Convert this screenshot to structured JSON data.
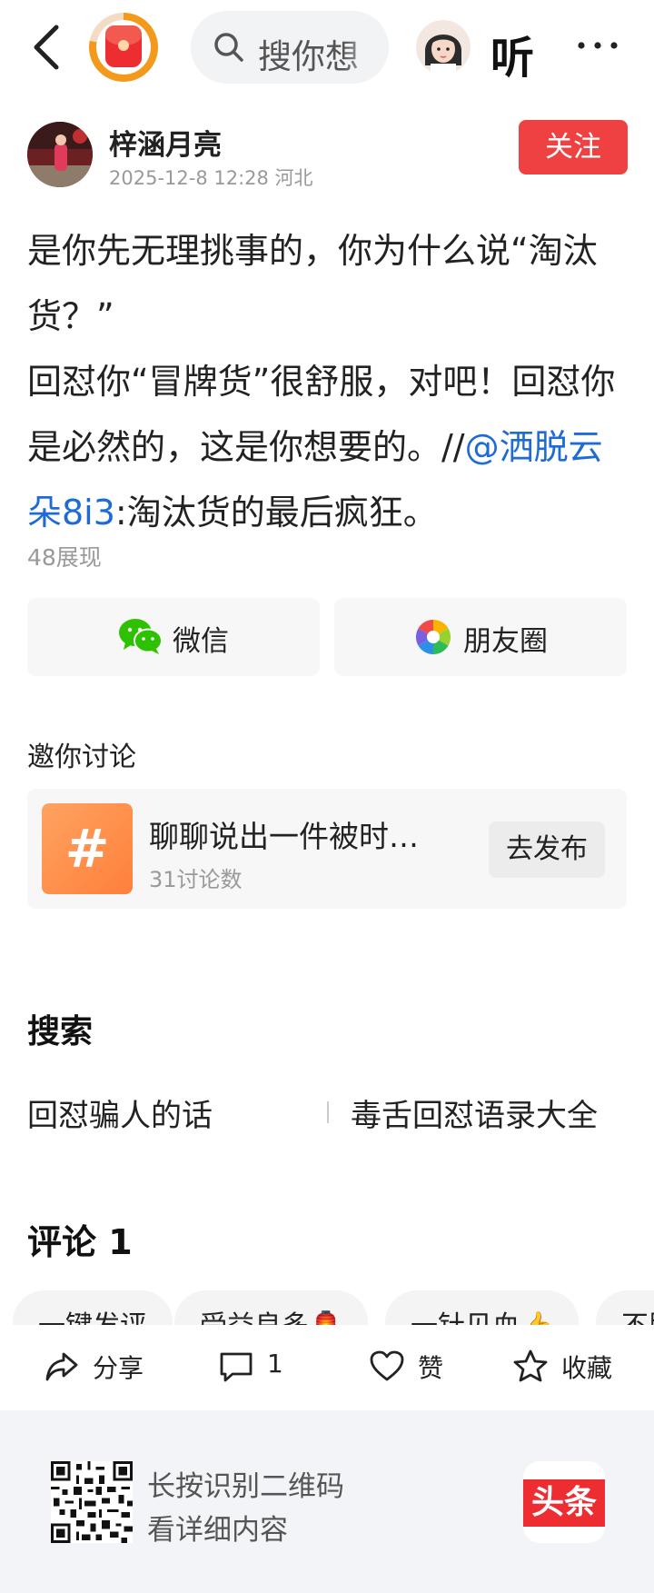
{
  "topbar": {
    "search_placeholder": "搜你想",
    "listen_label": "听"
  },
  "author": {
    "name": "梓涵月亮",
    "meta": "2025-12-8 12:28  河北",
    "follow_label": "关注"
  },
  "post": {
    "line1": "是你先无理挑事的，你为什么说“淘汰货？”",
    "line2_before_mention": "回怼你“冒牌货”很舒服，对吧！回怼你是必然的，这是你想要的。//",
    "mention": "@洒脱云朵8i3",
    "after_mention": ":淘汰货的最后疯狂。",
    "views": "48展现"
  },
  "share": {
    "wechat_label": "微信",
    "moments_label": "朋友圈"
  },
  "invite": {
    "title": "邀你讨论",
    "topic_title": "聊聊说出一件被时…",
    "topic_count": "31讨论数",
    "publish_label": "去发布",
    "topic_icon_glyph": "#"
  },
  "search_section": {
    "title": "搜索",
    "suggestions": [
      "回怼骗人的话",
      "毒舌回怼语录大全"
    ]
  },
  "comments": {
    "title": "评论 1",
    "chips": [
      "一键发评",
      "受益良多🏮",
      "一针见血👍",
      "不服"
    ]
  },
  "action_bar": {
    "share_label": "分享",
    "comment_count": "1",
    "like_label": "赞",
    "favorite_label": "收藏"
  },
  "footer": {
    "line1": "长按识别二维码",
    "line2": "看详细内容",
    "logo_text": "头条"
  },
  "colors": {
    "follow_red": "#f04142",
    "mention_blue": "#1e6bd6",
    "wechat_green": "#2dc100",
    "topic_orange": "#ff8a4a"
  },
  "icons": {
    "back": "chevron-left-icon",
    "search": "search-icon",
    "more": "more-dots-icon",
    "share": "share-arrow-icon",
    "comment": "comment-bubble-icon",
    "like": "heart-icon",
    "favorite": "star-icon",
    "wechat": "wechat-icon",
    "moments": "moments-aperture-icon",
    "red_packet": "red-packet-icon",
    "qr": "qr-code-icon"
  }
}
